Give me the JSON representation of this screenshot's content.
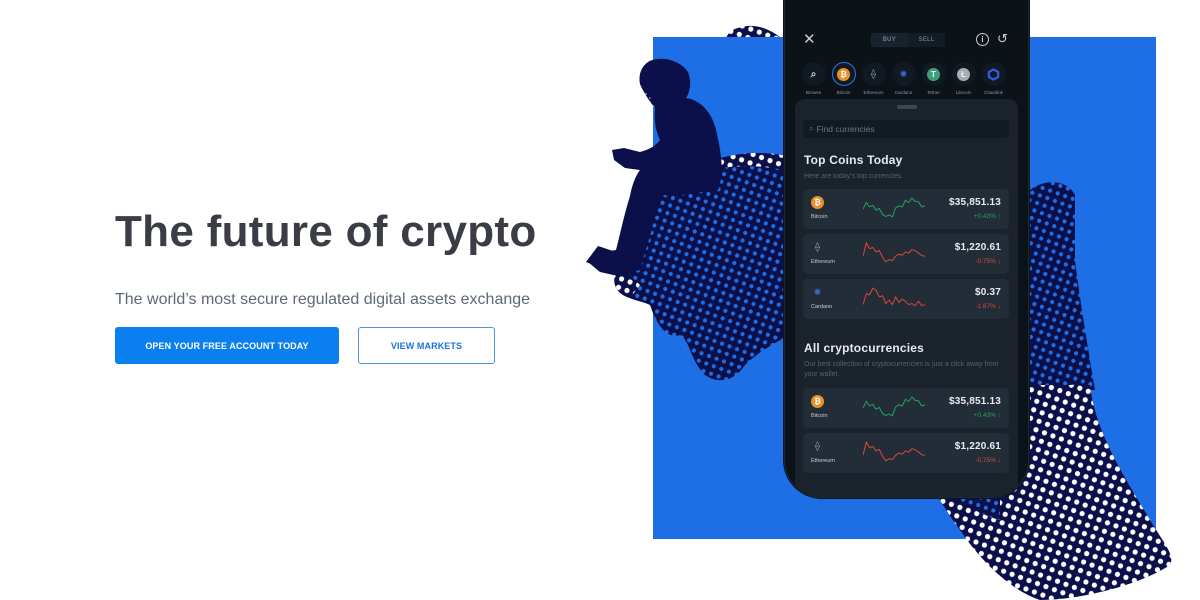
{
  "hero": {
    "title": "The future of crypto",
    "subtitle": "The world’s most secure regulated digital assets exchange",
    "primary_button": "OPEN YOUR FREE ACCOUNT TODAY",
    "secondary_button": "VIEW MARKETS"
  },
  "colors": {
    "primary": "#0a7ff0",
    "art_blue": "#1e6ee5",
    "art_navy": "#0b0f4a",
    "up": "#27a35c",
    "down": "#d9473a"
  },
  "phone": {
    "close_icon": "✕",
    "toggle": {
      "buy": "BUY",
      "sell": "SELL",
      "active": "buy"
    },
    "info_icon": "i",
    "history_icon": "↺",
    "coin_tabs": [
      {
        "label": "Browse",
        "icon": "search-icon",
        "glyph": "⌕"
      },
      {
        "label": "Bitcoin",
        "icon": "bitcoin-icon",
        "glyph": "₿",
        "selected": true
      },
      {
        "label": "Ethereum",
        "icon": "ethereum-icon",
        "glyph": "⟠"
      },
      {
        "label": "Cardano",
        "icon": "cardano-icon",
        "glyph": "✺"
      },
      {
        "label": "Tether",
        "icon": "tether-icon",
        "glyph": "T"
      },
      {
        "label": "Litecoin",
        "icon": "litecoin-icon",
        "glyph": "Ł"
      },
      {
        "label": "Chainlink",
        "icon": "chainlink-icon",
        "glyph": "⬡"
      }
    ],
    "search_placeholder": "Find currencies",
    "top_coins": {
      "title": "Top Coins Today",
      "subtitle": "Here are today's top currencies.",
      "rows": [
        {
          "name": "Bitcoin",
          "icon": "bitcoin-icon",
          "price": "$35,851.13",
          "change": "+0.43%",
          "direction": "up",
          "spark": [
            0.45,
            0.75,
            0.55,
            0.62,
            0.4,
            0.48,
            0.2,
            0.12,
            0.18,
            0.1,
            0.5,
            0.6,
            0.55,
            0.85,
            0.75,
            0.95,
            0.8,
            0.78,
            0.55,
            0.6
          ]
        },
        {
          "name": "Ethereum",
          "icon": "ethereum-icon",
          "price": "$1,220.61",
          "change": "-0.75%",
          "direction": "down",
          "spark": [
            0.35,
            0.95,
            0.7,
            0.75,
            0.55,
            0.62,
            0.3,
            0.1,
            0.2,
            0.15,
            0.35,
            0.45,
            0.4,
            0.55,
            0.5,
            0.65,
            0.6,
            0.5,
            0.38,
            0.35
          ]
        },
        {
          "name": "Cardano",
          "icon": "cardano-icon",
          "price": "$0.37",
          "change": "-1.87%",
          "direction": "down",
          "spark": [
            0.2,
            0.7,
            0.65,
            0.95,
            0.85,
            0.55,
            0.6,
            0.25,
            0.4,
            0.2,
            0.55,
            0.3,
            0.45,
            0.35,
            0.2,
            0.25,
            0.15,
            0.35,
            0.15,
            0.2
          ]
        }
      ]
    },
    "all_crypto": {
      "title": "All cryptocurrencies",
      "subtitle": "Our best collection of cryptocurrencies is just a click away from your wallet.",
      "rows": [
        {
          "name": "Bitcoin",
          "icon": "bitcoin-icon",
          "price": "$35,851.13",
          "change": "+0.43%",
          "direction": "up",
          "spark": [
            0.45,
            0.75,
            0.55,
            0.62,
            0.4,
            0.48,
            0.2,
            0.12,
            0.18,
            0.1,
            0.5,
            0.6,
            0.55,
            0.85,
            0.75,
            0.95,
            0.8,
            0.78,
            0.55,
            0.6
          ]
        },
        {
          "name": "Ethereum",
          "icon": "ethereum-icon",
          "price": "$1,220.61",
          "change": "-0.75%",
          "direction": "down",
          "spark": [
            0.35,
            0.95,
            0.7,
            0.75,
            0.55,
            0.62,
            0.3,
            0.1,
            0.2,
            0.15,
            0.35,
            0.45,
            0.4,
            0.55,
            0.5,
            0.65,
            0.6,
            0.5,
            0.38,
            0.35
          ]
        }
      ]
    }
  }
}
